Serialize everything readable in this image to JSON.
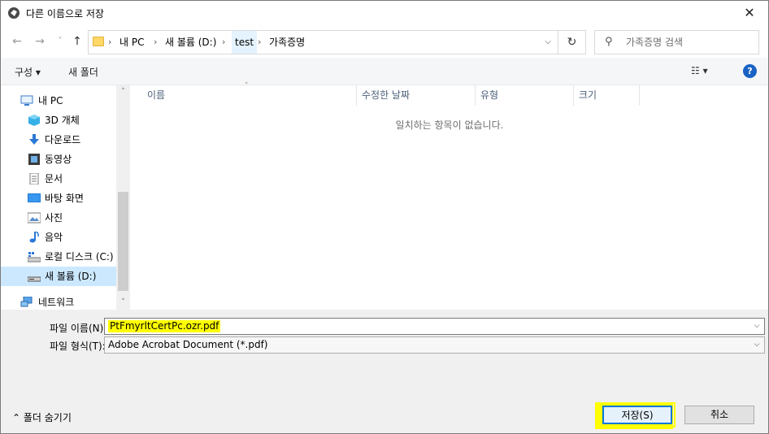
{
  "window": {
    "title": "다른 이름으로 저장",
    "close_glyph": "✕"
  },
  "nav": {
    "back_glyph": "←",
    "forward_glyph": "→",
    "recent_glyph": "˅",
    "up_glyph": "↑",
    "breadcrumbs": [
      "내 PC",
      "새 볼륨 (D:)",
      "test",
      "가족증명"
    ],
    "sep_glyph": "›",
    "dropdown_glyph": "⌵",
    "refresh_glyph": "↻",
    "search_placeholder": "가족증명 검색",
    "search_glyph": "⚲"
  },
  "toolbar": {
    "organize_label": "구성 ▾",
    "new_folder_label": "새 폴더",
    "view_glyph": "☷ ▾",
    "help_glyph": "?"
  },
  "sidebar": {
    "items": [
      {
        "label": "내 PC",
        "icon": "pc-icon"
      },
      {
        "label": "3D 개체",
        "icon": "3d-objects-icon"
      },
      {
        "label": "다운로드",
        "icon": "download-icon"
      },
      {
        "label": "동영상",
        "icon": "video-icon"
      },
      {
        "label": "문서",
        "icon": "document-icon"
      },
      {
        "label": "바탕 화면",
        "icon": "desktop-icon"
      },
      {
        "label": "사진",
        "icon": "pictures-icon"
      },
      {
        "label": "음악",
        "icon": "music-icon"
      },
      {
        "label": "로컬 디스크 (C:)",
        "icon": "drive-c-icon"
      },
      {
        "label": "새 볼륨 (D:)",
        "icon": "drive-d-icon"
      },
      {
        "label": "네트워크",
        "icon": "network-icon"
      }
    ],
    "scroll_up_glyph": "˄",
    "scroll_down_glyph": "˅"
  },
  "filelist": {
    "columns": [
      "이름",
      "수정한 날짜",
      "유형",
      "크기"
    ],
    "sort_glyph": "˄",
    "empty_message": "일치하는 항목이 없습니다."
  },
  "form": {
    "filename_label": "파일 이름(N):",
    "filename_value": "PtFmyrltCertPc.ozr.pdf",
    "filetype_label": "파일 형식(T):",
    "filetype_value": "Adobe Acrobat Document (*.pdf)",
    "drop_glyph": "⌵"
  },
  "footer": {
    "hide_folders_label": "⌃ 폴더 숨기기",
    "save_label": "저장(S)",
    "cancel_label": "취소"
  },
  "colors": {
    "highlight": "#ffff00",
    "accent": "#0078d7",
    "selected": "#cce8ff"
  }
}
